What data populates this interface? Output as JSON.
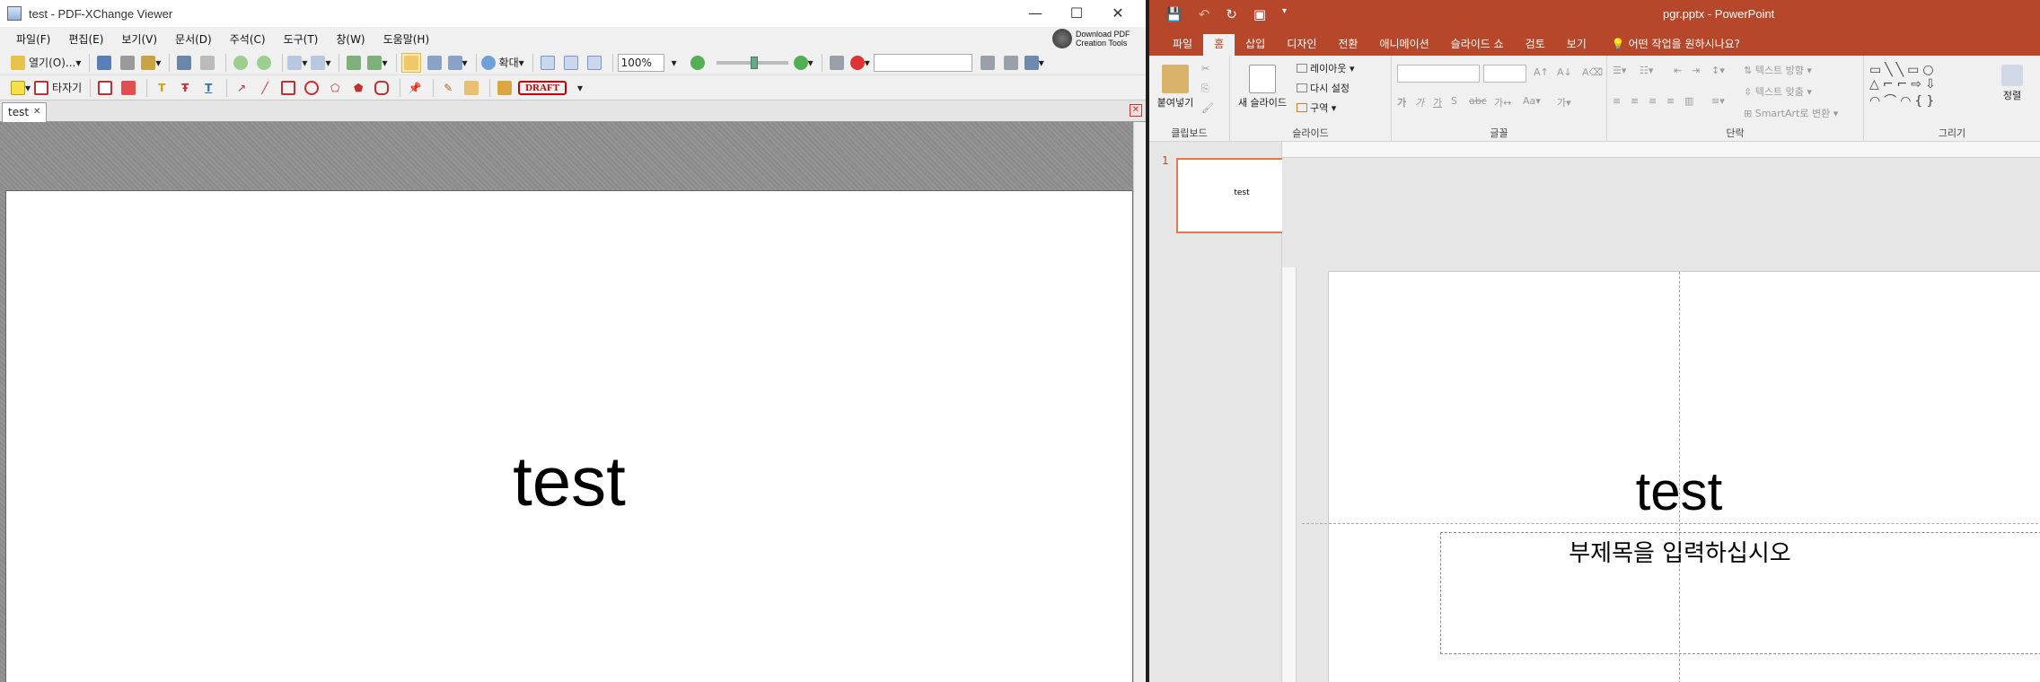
{
  "pdfx": {
    "window_title": "test - PDF-XChange Viewer",
    "menu": [
      "파일(F)",
      "편집(E)",
      "보기(V)",
      "문서(D)",
      "주석(C)",
      "도구(T)",
      "창(W)",
      "도움말(H)"
    ],
    "download_line1": "Download PDF",
    "download_line2": "Creation Tools",
    "toolbar": {
      "open_label": "열기(O)...",
      "zoom_label": "확대",
      "zoom_value": "100%",
      "typewriter_label": "타자기",
      "stamp_label": "DRAFT"
    },
    "tab_label": "test",
    "page_text": "test"
  },
  "ppt": {
    "doc_title": "pgr.pptx  -  PowerPoint",
    "tabs": [
      "파일",
      "홈",
      "삽입",
      "디자인",
      "전환",
      "애니메이션",
      "슬라이드 쇼",
      "검토",
      "보기"
    ],
    "active_tab": "홈",
    "tell_me": "어떤 작업을 원하시나요?",
    "ribbon": {
      "paste_label": "붙여넣기",
      "clipboard_group": "클립보드",
      "new_slide_label": "새 슬라이드",
      "layout_label": "레이아웃",
      "reset_label": "다시 설정",
      "section_label": "구역",
      "slides_group": "슬라이드",
      "font_group": "글꼴",
      "paragraph_group": "단락",
      "text_direction_label": "텍스트 방향",
      "align_text_label": "텍스트 맞춤",
      "smartart_label": "SmartArt로 변환",
      "drawing_group": "그리기",
      "arrange_label": "정렬"
    },
    "thumb_number": "1",
    "thumb_title": "test",
    "slide_title": "test",
    "slide_subtitle": "부제목을 입력하십시오"
  }
}
